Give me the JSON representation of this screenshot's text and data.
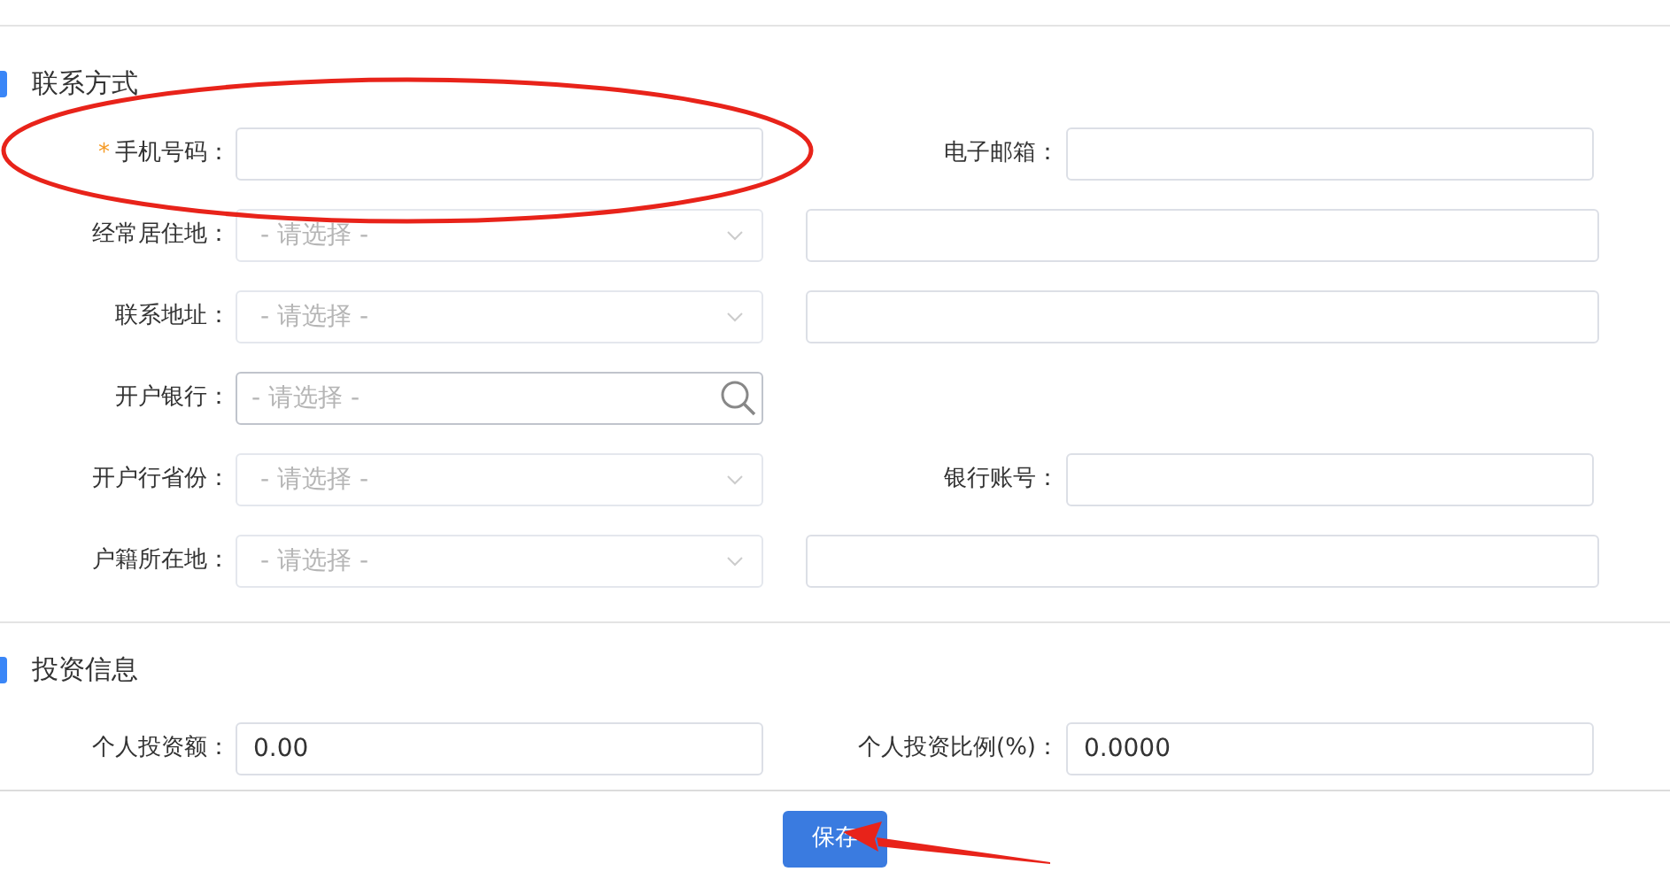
{
  "sections": [
    {
      "title": "联系方式",
      "rows": [
        {
          "left": {
            "label": "手机号码：",
            "required_mark": "*",
            "kind": "text"
          },
          "right": {
            "kind": "labeled",
            "label": "电子邮箱："
          }
        },
        {
          "left": {
            "label": "经常居住地：",
            "kind": "select",
            "placeholder": "- 请选择 -"
          },
          "right": {
            "kind": "wide"
          }
        },
        {
          "left": {
            "label": "联系地址：",
            "kind": "select",
            "placeholder": "- 请选择 -"
          },
          "right": {
            "kind": "wide"
          }
        },
        {
          "left": {
            "label": "开户银行：",
            "kind": "search",
            "placeholder": "- 请选择 -"
          },
          "right": {
            "kind": "none"
          }
        },
        {
          "left": {
            "label": "开户行省份：",
            "kind": "select",
            "placeholder": "- 请选择 -"
          },
          "right": {
            "kind": "labeled",
            "label": "银行账号："
          }
        },
        {
          "left": {
            "label": "户籍所在地：",
            "kind": "select",
            "placeholder": "- 请选择 -"
          },
          "right": {
            "kind": "wide"
          }
        }
      ]
    },
    {
      "title": "投资信息",
      "rows": [
        {
          "left": {
            "label": "个人投资额：",
            "kind": "text",
            "value": "0.00"
          },
          "right": {
            "kind": "labeled",
            "label": "个人投资比例(%)：",
            "value": "0.0000"
          }
        }
      ]
    }
  ],
  "save_button": "保存"
}
